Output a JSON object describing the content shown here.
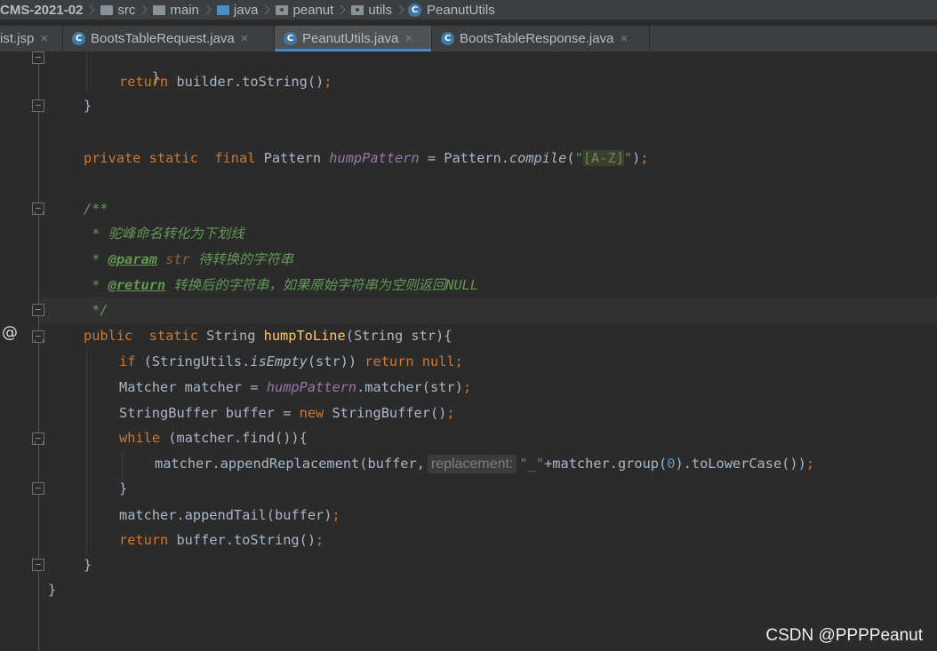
{
  "breadcrumb": {
    "project": "CMS-2021-02",
    "items": [
      "src",
      "main",
      "java",
      "peanut",
      "utils",
      "PeanutUtils"
    ]
  },
  "tabs": [
    {
      "label": "ist.jsp",
      "active": false
    },
    {
      "label": "BootsTableRequest.java",
      "active": false
    },
    {
      "label": "PeanutUtils.java",
      "active": true
    },
    {
      "label": "BootsTableResponse.java",
      "active": false
    }
  ],
  "icons": {
    "class": "C",
    "close": "×",
    "implements_marker": "@"
  },
  "colors": {
    "background": "#2b2b2b",
    "keyword": "#cc7832",
    "field": "#9876aa",
    "string": "#6a8759",
    "method_decl": "#ffc66d",
    "doc_comment": "#629755",
    "active_tab_underline": "#4a88c7"
  },
  "code": {
    "l0": "}",
    "l1_kw": "return",
    "l1_rest": " builder.toString()",
    "l2": "}",
    "l4_kw1": "private static  final",
    "l4_type": " Pattern ",
    "l4_field": "humpPattern",
    "l4_eq": " = Pattern.",
    "l4_call": "compile",
    "l4_open": "(",
    "l4_q1": "\"",
    "l4_regex": "[A-Z]",
    "l4_q2": "\"",
    "l4_close": ")",
    "semicolon": ";",
    "l6": "/**",
    "l7": " * 驼峰命名转化为下划线",
    "l8_star": " * ",
    "l8_tag": "@param",
    "l8_param": " str",
    "l8_desc": " 待转换的字符串",
    "l9_star": " * ",
    "l9_tag": "@return",
    "l9_desc": " 转换后的字符串，如果原始字符串为空则返回NULL",
    "l10": " */",
    "l11_kw": "public  static",
    "l11_type": " String ",
    "l11_fn": "humpToLine",
    "l11_rest": "(String str){",
    "l12_kw": "if",
    "l12_a": " (StringUtils.",
    "l12_call": "isEmpty",
    "l12_b": "(str)) ",
    "l12_kw2": "return null",
    "l13_a": "Matcher matcher = ",
    "l13_field": "humpPattern",
    "l13_b": ".matcher(str)",
    "l14_a": "StringBuffer buffer = ",
    "l14_kw": "new",
    "l14_b": " StringBuffer()",
    "l15_kw": "while",
    "l15_rest": " (matcher.find()){",
    "l16_a": "matcher.appendReplacement(buffer,",
    "l16_hint": "replacement:",
    "l16_str": "\"_\"",
    "l16_b": "+matcher.group(",
    "l16_num": "0",
    "l16_c": ").toLowerCase())",
    "l17": "}",
    "l18": "matcher.appendTail(buffer)",
    "l19_kw": "return",
    "l19_rest": " buffer.toString()",
    "l20": "}",
    "l21": "}"
  },
  "watermark": "CSDN @PPPPeanut"
}
